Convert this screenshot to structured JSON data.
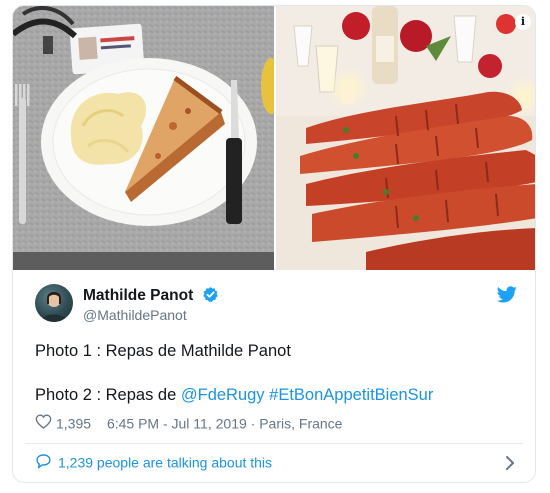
{
  "media": {
    "left_photo": "cafeteria-tray-quiche-mashed-potatoes",
    "right_photo": "lobster-dinner-candles-wine",
    "info_icon": "i"
  },
  "author": {
    "name": "Mathilde Panot",
    "handle": "@MathildePanot",
    "verified": true
  },
  "tweet": {
    "line1": "Photo 1 : Repas de Mathilde Panot",
    "line2_prefix": "Photo 2 : Repas de ",
    "mention": "@FdeRugy",
    "hashtag": "#EtBonAppetitBienSur"
  },
  "meta": {
    "likes": "1,395",
    "timestamp": "6:45 PM - Jul 11, 2019",
    "location": "Paris, France"
  },
  "conversation": {
    "label": "1,239 people are talking about this"
  },
  "colors": {
    "link": "#1b95e0",
    "muted": "#657786",
    "verified": "#1da1f2",
    "twitter_blue": "#1da1f2"
  }
}
